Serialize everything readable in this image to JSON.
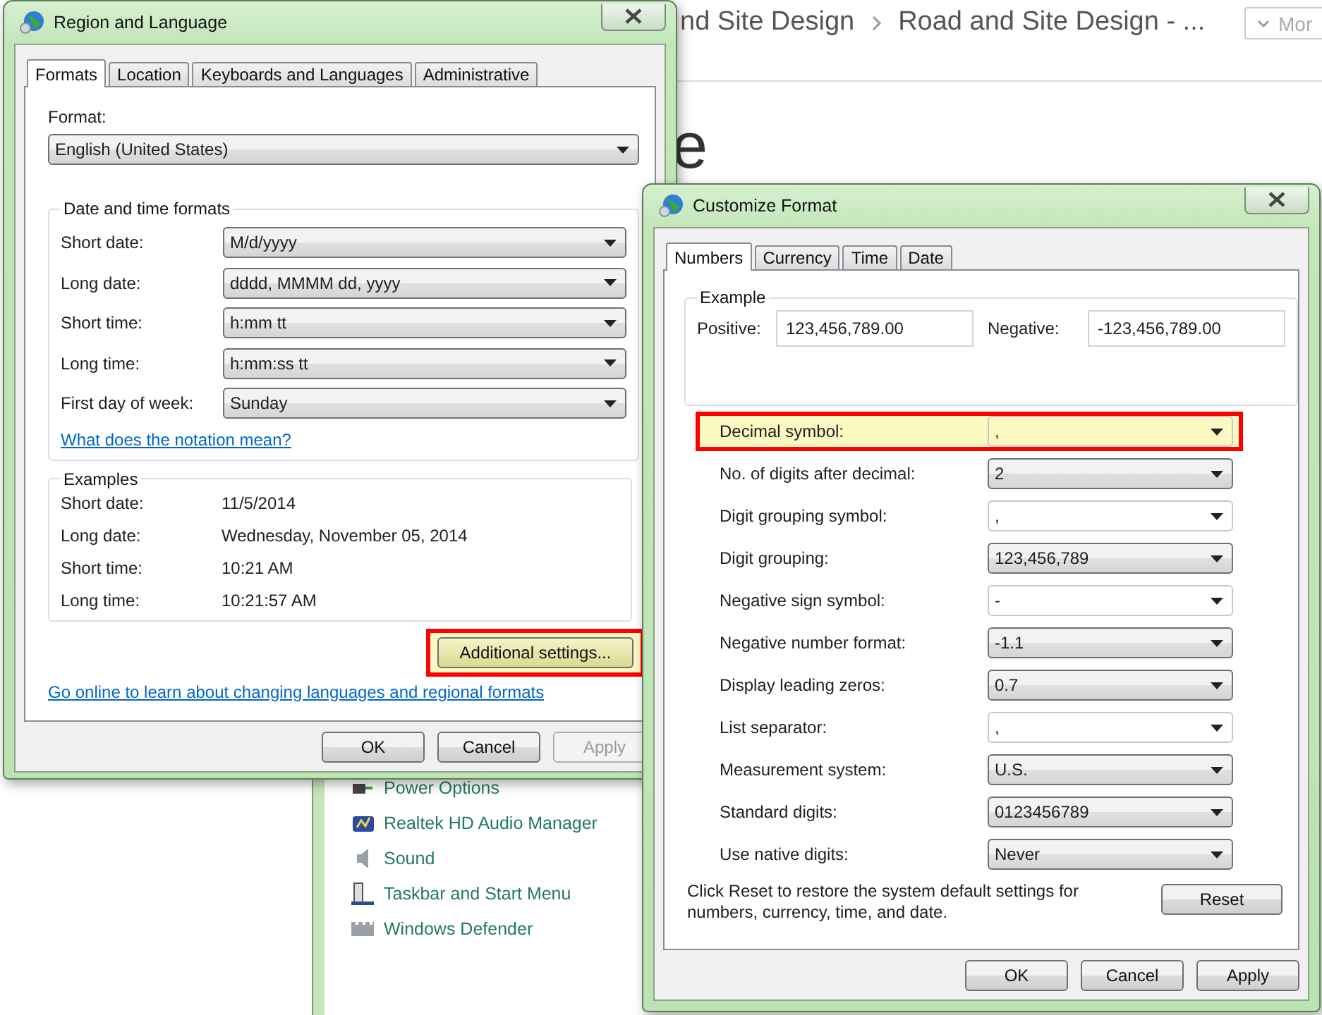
{
  "background_page": {
    "breadcrumb": [
      "nd Site Design",
      "Road and Site Design - ..."
    ],
    "more_button": "Mor",
    "heading": "e"
  },
  "control_panel_items": [
    {
      "label": "Power Options"
    },
    {
      "label": "Realtek HD Audio Manager"
    },
    {
      "label": "Sound"
    },
    {
      "label": "Taskbar and Start Menu"
    },
    {
      "label": "Windows Defender"
    }
  ],
  "region_dialog": {
    "title": "Region and Language",
    "tabs": [
      {
        "label": "Formats",
        "selected": true
      },
      {
        "label": "Location",
        "selected": false
      },
      {
        "label": "Keyboards and Languages",
        "selected": false
      },
      {
        "label": "Administrative",
        "selected": false
      }
    ],
    "format_label": "Format:",
    "format_value": "English (United States)",
    "date_time_group": {
      "title": "Date and time formats",
      "rows": [
        {
          "label": "Short date:",
          "value": "M/d/yyyy"
        },
        {
          "label": "Long date:",
          "value": "dddd, MMMM dd, yyyy"
        },
        {
          "label": "Short time:",
          "value": "h:mm tt"
        },
        {
          "label": "Long time:",
          "value": "h:mm:ss tt"
        },
        {
          "label": "First day of week:",
          "value": "Sunday"
        }
      ],
      "link": "What does the notation mean?"
    },
    "examples_group": {
      "title": "Examples",
      "rows": [
        {
          "label": "Short date:",
          "value": "11/5/2014"
        },
        {
          "label": "Long date:",
          "value": "Wednesday, November 05, 2014"
        },
        {
          "label": "Short time:",
          "value": "10:21 AM"
        },
        {
          "label": "Long time:",
          "value": "10:21:57 AM"
        }
      ]
    },
    "additional_button": {
      "label": "Additional settings...",
      "highlighted": true
    },
    "online_link": "Go online to learn about changing languages and regional formats",
    "buttons": [
      {
        "label": "OK",
        "disabled": false
      },
      {
        "label": "Cancel",
        "disabled": false
      },
      {
        "label": "Apply",
        "disabled": true
      }
    ]
  },
  "customize_dialog": {
    "title": "Customize Format",
    "tabs": [
      {
        "label": "Numbers",
        "selected": true
      },
      {
        "label": "Currency",
        "selected": false
      },
      {
        "label": "Time",
        "selected": false
      },
      {
        "label": "Date",
        "selected": false
      }
    ],
    "example_group": {
      "title": "Example",
      "positive_label": "Positive:",
      "positive_value": "123,456,789.00",
      "negative_label": "Negative:",
      "negative_value": "-123,456,789.00"
    },
    "settings": [
      {
        "label": "Decimal symbol:",
        "value": ",",
        "kind": "editable",
        "highlighted": true
      },
      {
        "label": "No. of digits after decimal:",
        "value": "2",
        "kind": "list",
        "highlighted": false
      },
      {
        "label": "Digit grouping symbol:",
        "value": ",",
        "kind": "editable",
        "highlighted": false
      },
      {
        "label": "Digit grouping:",
        "value": "123,456,789",
        "kind": "list",
        "highlighted": false
      },
      {
        "label": "Negative sign symbol:",
        "value": "-",
        "kind": "editable",
        "highlighted": false
      },
      {
        "label": "Negative number format:",
        "value": "-1.1",
        "kind": "list",
        "highlighted": false
      },
      {
        "label": "Display leading zeros:",
        "value": "0.7",
        "kind": "list",
        "highlighted": false
      },
      {
        "label": "List separator:",
        "value": ",",
        "kind": "editable",
        "highlighted": false
      },
      {
        "label": "Measurement system:",
        "value": "U.S.",
        "kind": "list",
        "highlighted": false
      },
      {
        "label": "Standard digits:",
        "value": "0123456789",
        "kind": "list",
        "highlighted": false
      },
      {
        "label": "Use native digits:",
        "value": "Never",
        "kind": "list",
        "highlighted": false
      }
    ],
    "reset_note": "Click Reset to restore the system default settings for numbers, currency, time, and date.",
    "reset_button": "Reset",
    "buttons": [
      {
        "label": "OK",
        "disabled": false
      },
      {
        "label": "Cancel",
        "disabled": false
      },
      {
        "label": "Apply",
        "disabled": false
      }
    ]
  }
}
